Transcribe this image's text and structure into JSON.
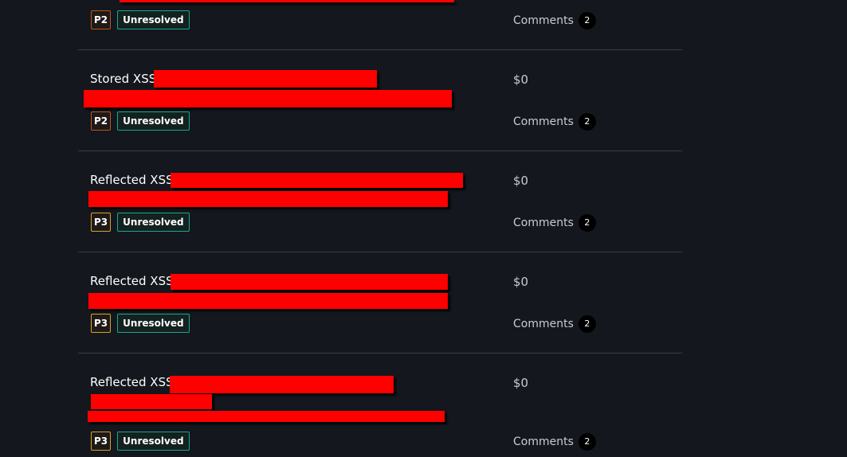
{
  "reports": [
    {
      "title": "",
      "priority": "P2",
      "status": "Unresolved",
      "bounty": "",
      "comments_label": "Comments",
      "comments_count": "2"
    },
    {
      "title": "Stored XSS",
      "priority": "P2",
      "status": "Unresolved",
      "bounty": "$0",
      "comments_label": "Comments",
      "comments_count": "2"
    },
    {
      "title": "Reflected XSS",
      "priority": "P3",
      "status": "Unresolved",
      "bounty": "$0",
      "comments_label": "Comments",
      "comments_count": "2"
    },
    {
      "title": "Reflected XSS",
      "priority": "P3",
      "status": "Unresolved",
      "bounty": "$0",
      "comments_label": "Comments",
      "comments_count": "2"
    },
    {
      "title": "Reflected XSS",
      "priority": "P3",
      "status": "Unresolved",
      "bounty": "$0",
      "comments_label": "Comments",
      "comments_count": "2"
    }
  ],
  "colors": {
    "background": "#14171d",
    "redaction": "#ff0000",
    "p2_border": "#c0551a",
    "p3_border": "#d8a030",
    "status_border": "#1aa791"
  }
}
